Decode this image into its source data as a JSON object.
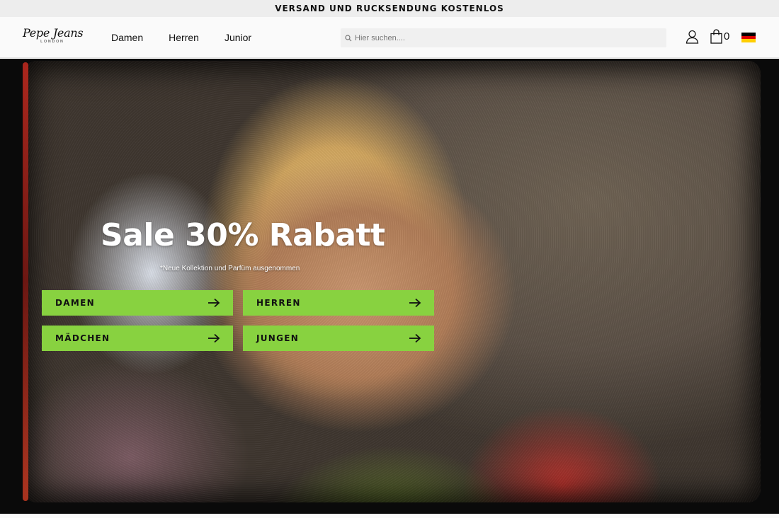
{
  "promo": {
    "text": "VERSAND UND RUCKSENDUNG KOSTENLOS"
  },
  "header": {
    "logo": {
      "main": "Pepe Jeans",
      "sub": "LONDON"
    },
    "nav": [
      {
        "label": "Damen"
      },
      {
        "label": "Herren"
      },
      {
        "label": "Junior"
      }
    ],
    "search": {
      "placeholder": "Hier suchen....",
      "value": "",
      "icon": "search-icon"
    },
    "icons": {
      "account": "user-icon",
      "cart": "bag-icon",
      "country": "germany-flag-icon"
    },
    "cart_count": "0"
  },
  "hero": {
    "title": "Sale 30% Rabatt",
    "note": "*Neue Kollektion und Parfüm ausgenommen",
    "buttons": [
      {
        "label": "DAMEN",
        "icon": "arrow-right-icon"
      },
      {
        "label": "HERREN",
        "icon": "arrow-right-icon"
      },
      {
        "label": "MÄDCHEN",
        "icon": "arrow-right-icon"
      },
      {
        "label": "JUNGEN",
        "icon": "arrow-right-icon"
      }
    ]
  },
  "colors": {
    "accent": "#88d240",
    "promo_bg": "#ededed",
    "header_bg": "#fafafa",
    "text": "#111111",
    "flag": [
      "#000000",
      "#dd0000",
      "#ffce00"
    ]
  }
}
